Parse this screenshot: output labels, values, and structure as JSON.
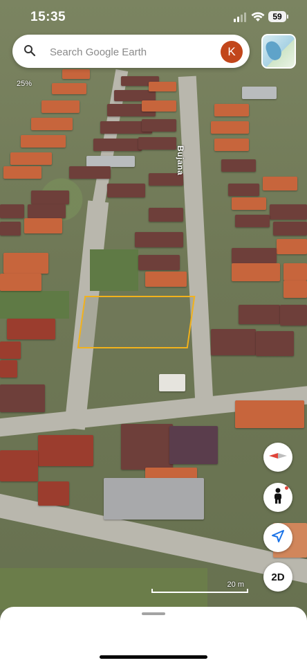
{
  "status_bar": {
    "time": "15:35",
    "battery": "59"
  },
  "search": {
    "placeholder": "Search Google Earth",
    "avatar_initial": "K"
  },
  "map": {
    "zoom_percent": "25%",
    "street_label": "Bujana",
    "scale_label": "20 m",
    "parcel_outline_color": "#f2b21c"
  },
  "controls": {
    "compass_icon": "compass-icon",
    "street_view_icon": "pegman-icon",
    "location_icon": "navigation-arrow-icon",
    "view_mode_label": "2D"
  },
  "colors": {
    "avatar": "#c2461b",
    "compass_needle": "#e0443a"
  }
}
